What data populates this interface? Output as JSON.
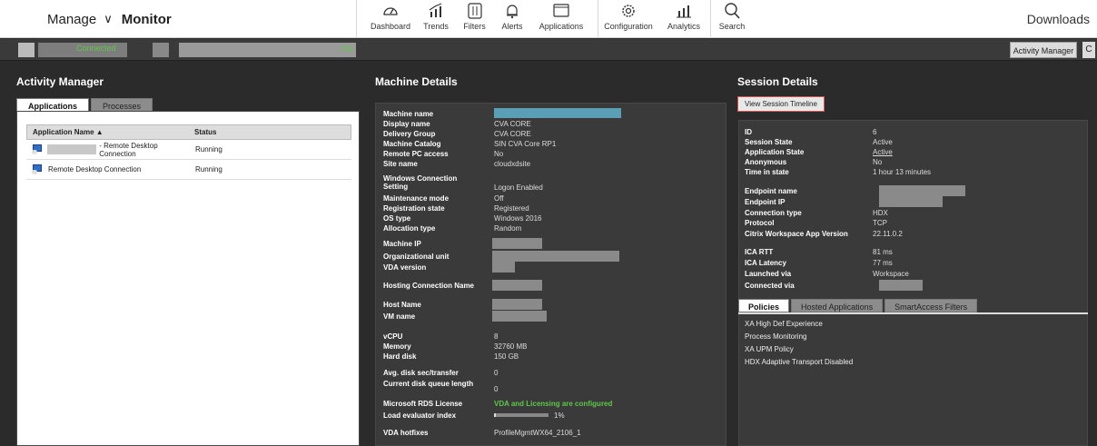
{
  "nav": {
    "manage": "Manage",
    "monitor": "Monitor",
    "downloads": "Downloads",
    "tools": [
      {
        "label": "Dashboard",
        "icon": "dashboard-icon"
      },
      {
        "label": "Trends",
        "icon": "trends-icon"
      },
      {
        "label": "Filters",
        "icon": "filters-icon"
      },
      {
        "label": "Alerts",
        "icon": "alerts-icon"
      },
      {
        "label": "Applications",
        "icon": "applications-icon"
      },
      {
        "label": "Configuration",
        "icon": "configuration-icon"
      },
      {
        "label": "Analytics",
        "icon": "analytics-icon"
      },
      {
        "label": "Search",
        "icon": "search-icon"
      }
    ]
  },
  "status": {
    "connected": "Connected",
    "on": "ON",
    "activity_manager": "Activity Manager",
    "refresh": "C"
  },
  "activity": {
    "title": "Activity Manager",
    "tabs": [
      "Applications",
      "Processes"
    ],
    "columns": [
      "Application Name ▲",
      "Status"
    ],
    "rows": [
      {
        "name": "- Remote Desktop Connection",
        "status": "Running"
      },
      {
        "name": "Remote Desktop Connection",
        "status": "Running"
      }
    ]
  },
  "machine": {
    "title": "Machine Details",
    "fields": [
      {
        "k": "Machine name",
        "v": ""
      },
      {
        "k": "Display name",
        "v": "CVA CORE"
      },
      {
        "k": "Delivery Group",
        "v": "CVA CORE"
      },
      {
        "k": "Machine Catalog",
        "v": "SIN CVA Core RP1"
      },
      {
        "k": "Remote PC access",
        "v": "No"
      },
      {
        "k": "Site name",
        "v": "cloudxdsite"
      },
      {
        "k": "Windows Connection Setting",
        "v": "Logon Enabled"
      },
      {
        "k": "Maintenance mode",
        "v": "Off"
      },
      {
        "k": "Registration state",
        "v": "Registered"
      },
      {
        "k": "OS type",
        "v": "Windows 2016"
      },
      {
        "k": "Allocation type",
        "v": "Random"
      },
      {
        "k": "Machine IP",
        "v": ""
      },
      {
        "k": "Organizational unit",
        "v": ""
      },
      {
        "k": "VDA version",
        "v": ""
      },
      {
        "k": "Hosting Connection Name",
        "v": ""
      },
      {
        "k": "Host Name",
        "v": ""
      },
      {
        "k": "VM name",
        "v": ""
      },
      {
        "k": "vCPU",
        "v": "8"
      },
      {
        "k": "Memory",
        "v": "32760 MB"
      },
      {
        "k": "Hard disk",
        "v": "150 GB"
      },
      {
        "k": "Avg. disk sec/transfer",
        "v": "0"
      },
      {
        "k": "Current disk queue length",
        "v": "0"
      },
      {
        "k": "Microsoft RDS License",
        "v": "VDA and Licensing are configured"
      },
      {
        "k": "Load evaluator index",
        "v": "1%"
      },
      {
        "k": "VDA hotfixes",
        "v": "ProfileMgmtWX64_2106_1"
      }
    ],
    "load_index_fraction": 0.01
  },
  "session": {
    "title": "Session Details",
    "timeline_button": "View Session Timeline",
    "fields": [
      {
        "k": "ID",
        "v": "6"
      },
      {
        "k": "Session State",
        "v": "Active"
      },
      {
        "k": "Application State",
        "v": "Active"
      },
      {
        "k": "Anonymous",
        "v": "No"
      },
      {
        "k": "Time in state",
        "v": "1 hour 13 minutes"
      },
      {
        "k": "Endpoint name",
        "v": ""
      },
      {
        "k": "Endpoint IP",
        "v": ""
      },
      {
        "k": "Connection type",
        "v": "HDX"
      },
      {
        "k": "Protocol",
        "v": "TCP"
      },
      {
        "k": "Citrix Workspace App Version",
        "v": "22.11.0.2"
      },
      {
        "k": "ICA RTT",
        "v": "81 ms"
      },
      {
        "k": "ICA Latency",
        "v": "77 ms"
      },
      {
        "k": "Launched via",
        "v": "Workspace"
      },
      {
        "k": "Connected via",
        "v": ""
      }
    ],
    "tabs": [
      "Policies",
      "Hosted Applications",
      "SmartAccess Filters"
    ],
    "policies": [
      "XA High Def Experience",
      "Process Monitoring",
      "XA UPM Policy",
      "HDX Adaptive Transport Disabled"
    ]
  },
  "colors": {
    "connected": "#5fc74a",
    "on": "#5fc74a",
    "highlight": "#d9534f"
  }
}
